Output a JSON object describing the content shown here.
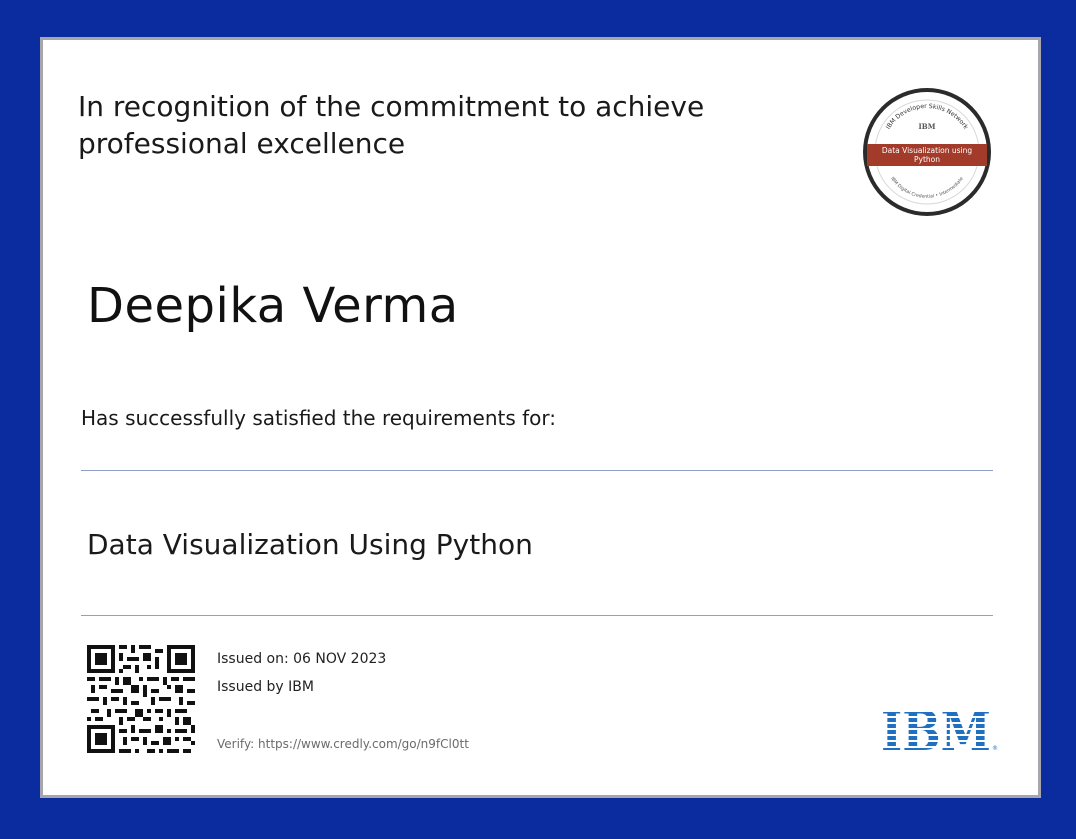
{
  "certificate": {
    "recognition_line1": "In recognition of the commitment to achieve",
    "recognition_line2": "professional excellence",
    "recipient_name": "Deepika Verma",
    "satisfied_text": "Has successfully satisfied the requirements for:",
    "course_title": "Data Visualization Using Python",
    "issued_on": "Issued on: 06 NOV 2023",
    "issued_by": "Issued by IBM",
    "verify": "Verify: https://www.credly.com/go/n9fCl0tt"
  },
  "badge": {
    "arc_top_text": "IBM Developer Skills Network",
    "brand": "IBM",
    "ribbon_line1": "Data Visualization using",
    "ribbon_line2": "Python",
    "arc_bottom_text": "IBM Digital Credential • Intermediate",
    "ribbon_color": "#a33b2a"
  },
  "logo": {
    "text": "IBM",
    "color": "#1f70c1"
  },
  "colors": {
    "frame": "#0a2c9f",
    "rule": "#8ea0c8"
  }
}
